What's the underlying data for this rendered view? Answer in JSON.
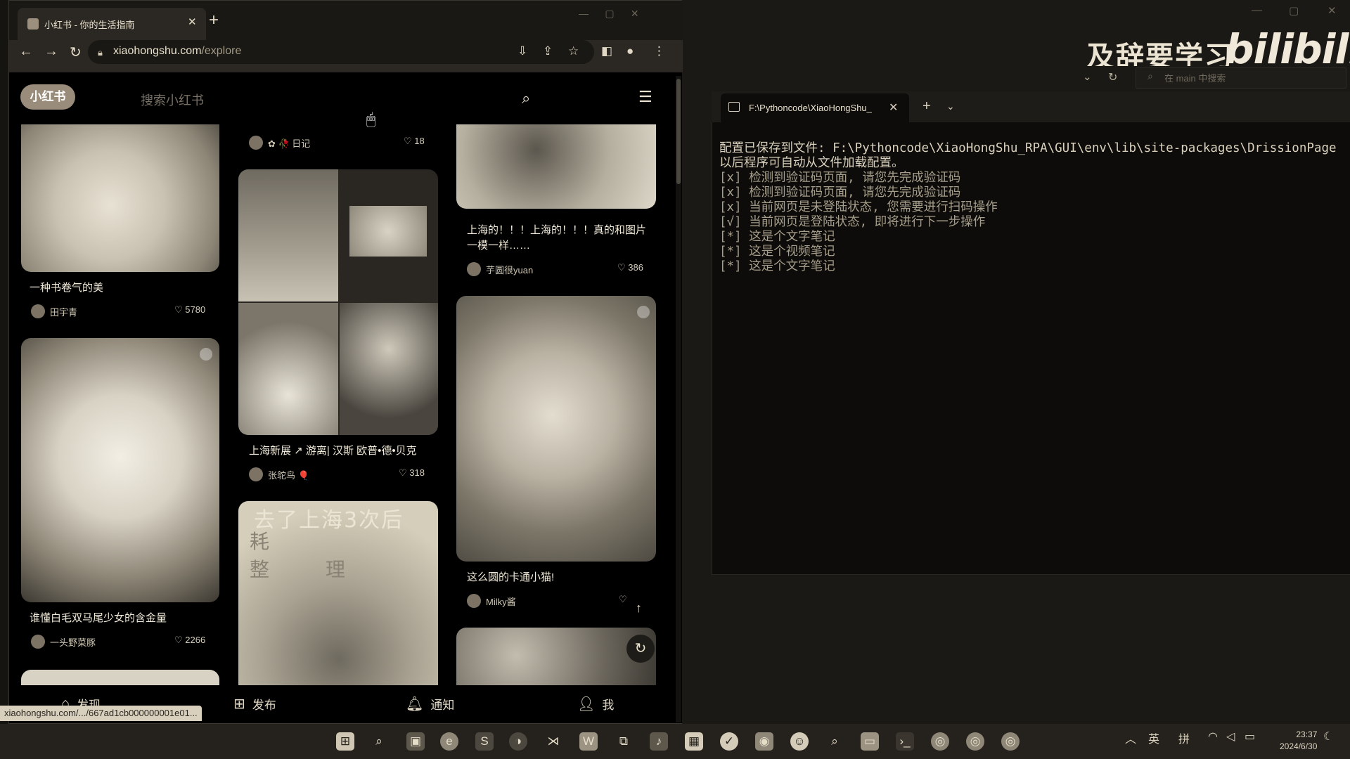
{
  "browser": {
    "tab_title": "小红书 - 你的生活指南",
    "url_host": "xiaohongshu.com",
    "url_path": "/explore",
    "status_url": "xiaohongshu.com/.../667ad1cb000000001e01..."
  },
  "xhs": {
    "logo": "小红书",
    "search_placeholder": "搜索小红书",
    "cards": [
      {
        "title": "",
        "user": "✿ 🥀 日记",
        "likes": "18"
      },
      {
        "title": "上海的！！！上海的！！！真的和图片一模一样……",
        "user": "芋圆很yuan",
        "likes": "386"
      },
      {
        "title": "一种书卷气的美",
        "user": "田宇青",
        "likes": "5780"
      },
      {
        "title": "上海新展 ↗ 游离| 汉斯 欧普•德•贝克",
        "user": "张鸵鸟 🎈",
        "likes": "318"
      },
      {
        "title": "这么圆的卡通小猫!",
        "user": "Milky酱",
        "likes": ""
      },
      {
        "title": "谁懂白毛双马尾少女的含金量",
        "user": "一头野菜豚",
        "likes": "2266"
      }
    ],
    "poster_text": "去了上海3次后",
    "poster_text2": "耗  整理",
    "bottom_nav": {
      "discover": "发现",
      "publish": "发布",
      "notify": "通知",
      "me": "我"
    }
  },
  "desktop": {
    "watermark_text": "及辞要学习",
    "watermark_logo": "bilibili",
    "explorer_search_placeholder": "在 main 中搜索"
  },
  "terminal": {
    "tab_title": "F:\\Pythoncode\\XiaoHongShu_",
    "lines": [
      "配置已保存到文件: F:\\Pythoncode\\XiaoHongShu_RPA\\GUI\\env\\lib\\site-packages\\DrissionPage",
      "以后程序可自动从文件加载配置。",
      "[x] 检测到验证码页面, 请您先完成验证码",
      "[x] 检测到验证码页面, 请您先完成验证码",
      "[x] 当前网页是未登陆状态, 您需要进行扫码操作",
      "[√] 当前网页是登陆状态, 即将进行下一步操作",
      "[*] 这是个文字笔记",
      "[*] 这是个视频笔记",
      "[*] 这是个文字笔记"
    ]
  },
  "taskbar": {
    "ime_lang": "英",
    "ime_mode": "拼",
    "time": "23:37",
    "date": "2024/6/30"
  },
  "colors": {
    "accent": "#9a8c7a",
    "terminal_bg": "#0d0c0a",
    "page_bg": "#000000"
  }
}
